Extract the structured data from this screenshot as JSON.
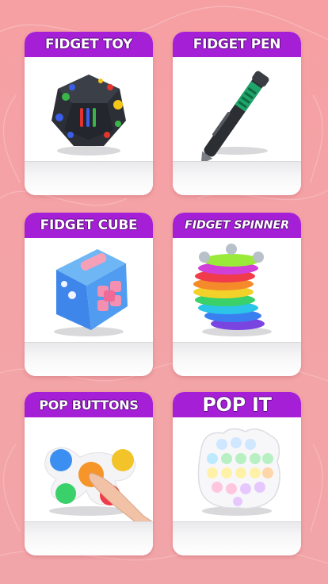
{
  "cards": [
    {
      "title": "FIDGET TOY"
    },
    {
      "title": "FIDGET PEN"
    },
    {
      "title": "FIDGET CUBE"
    },
    {
      "title": "FIDGET SPINNER"
    },
    {
      "title": "POP BUTTONS"
    },
    {
      "title": "POP IT"
    }
  ],
  "colors": {
    "background": "#f4a2a6",
    "banner": "#a51fd6",
    "card": "#ffffff"
  }
}
